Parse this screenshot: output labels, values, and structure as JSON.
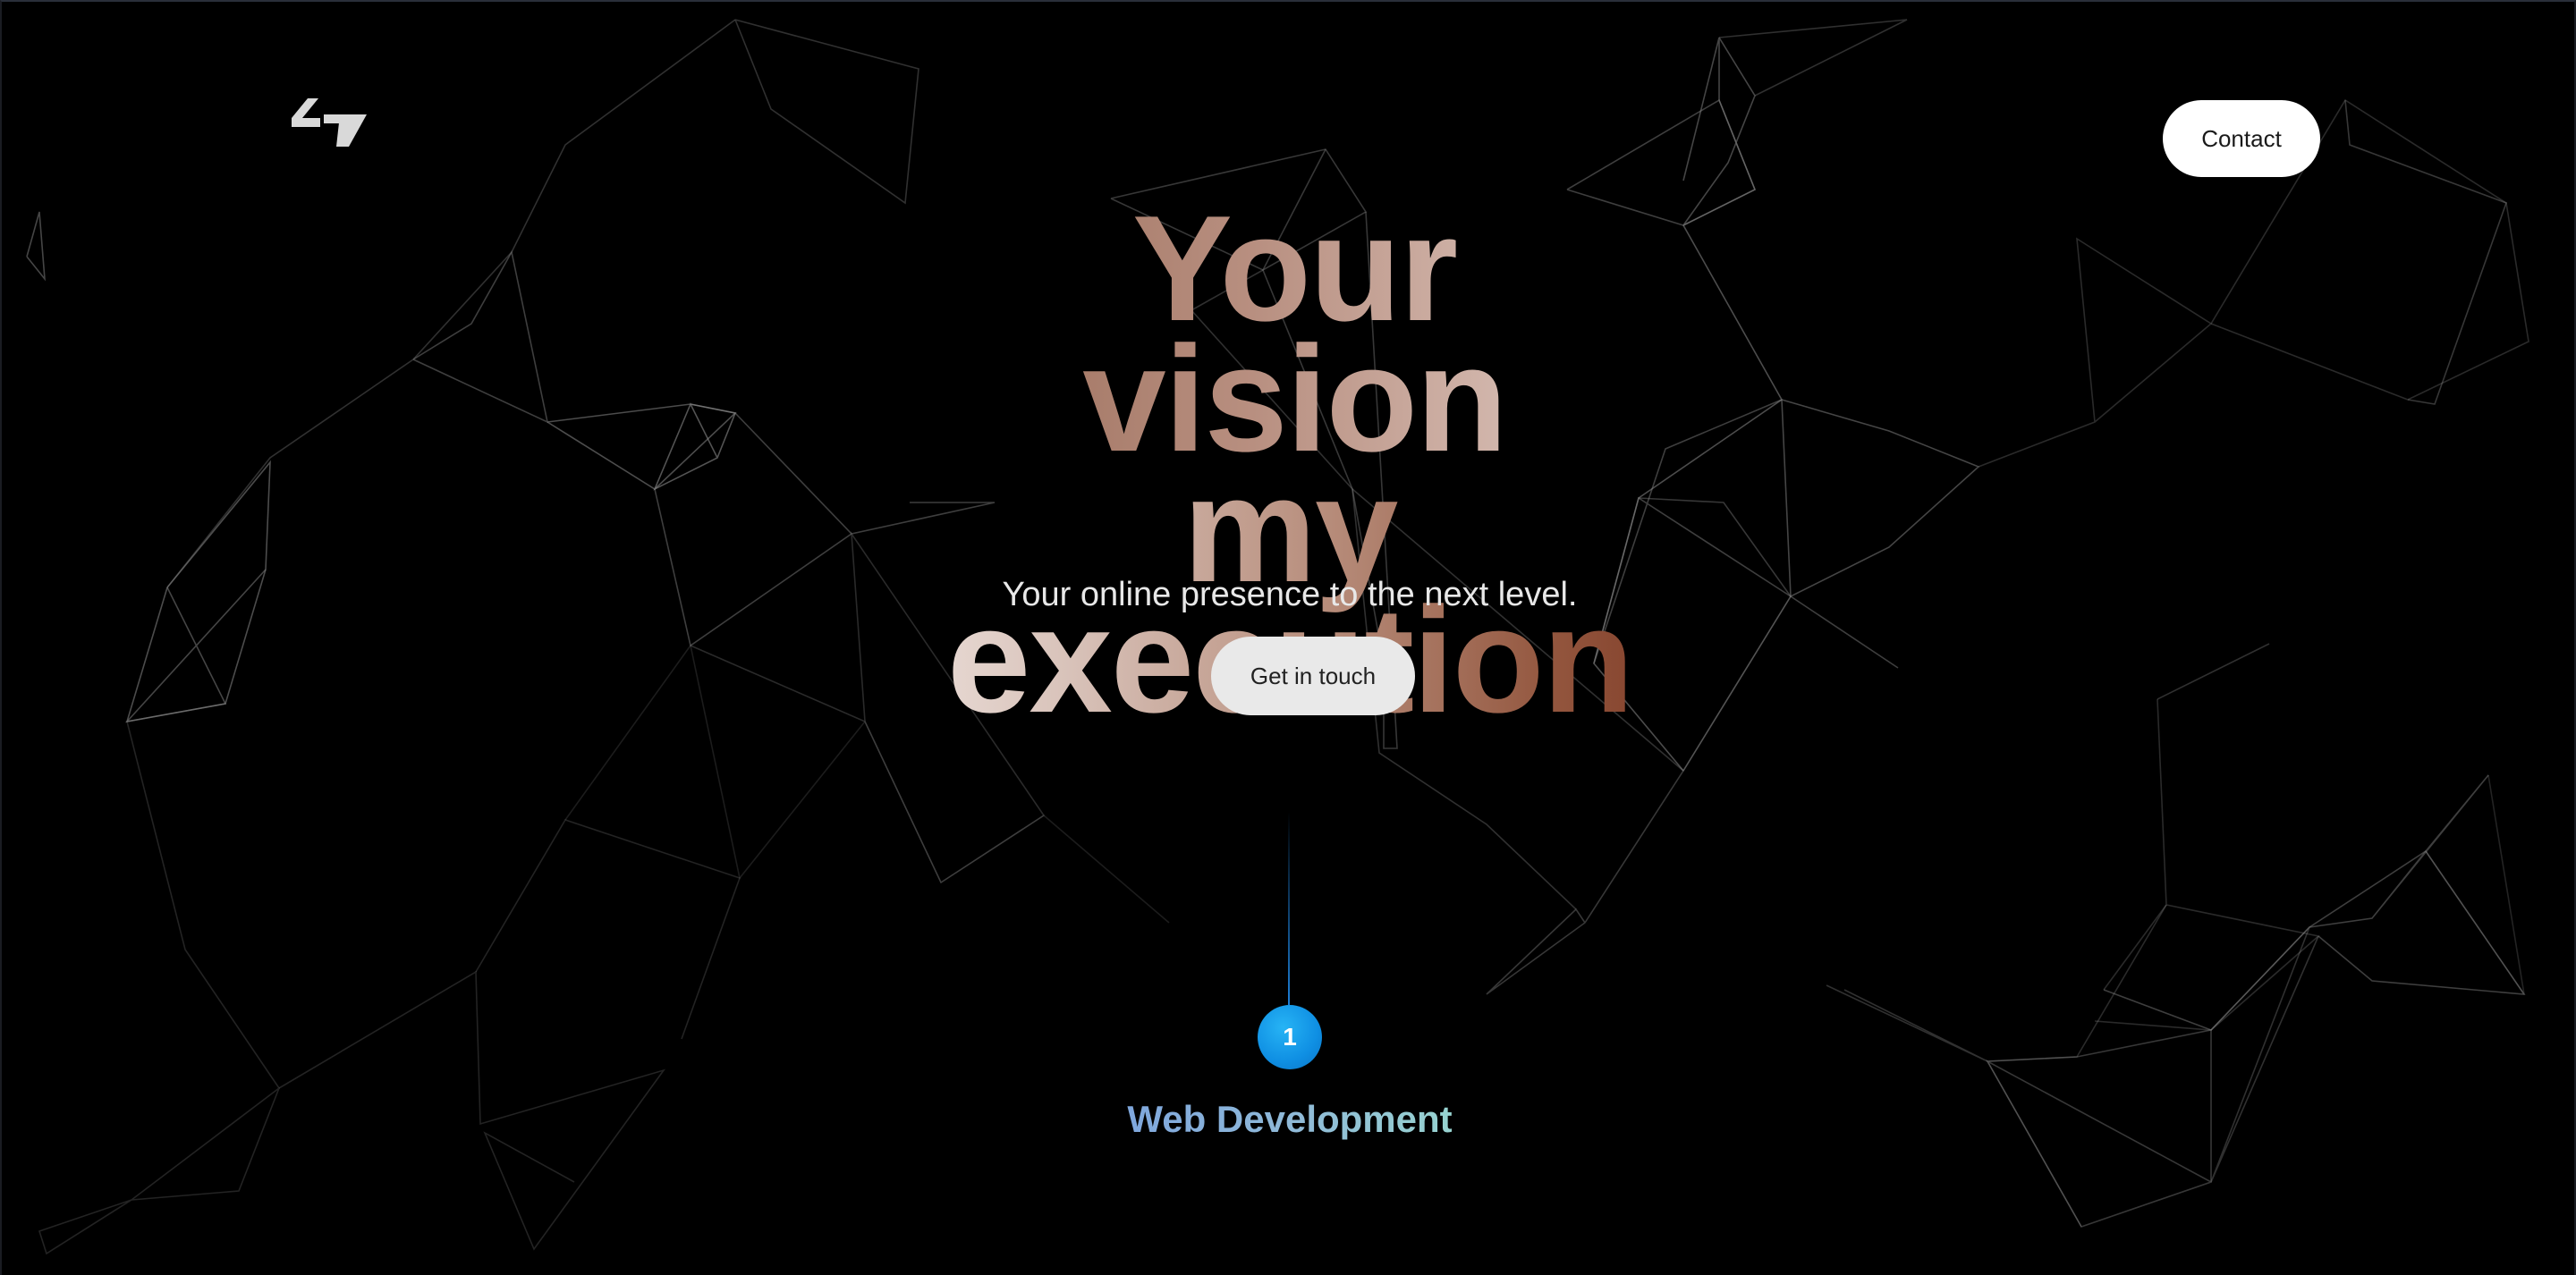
{
  "header": {
    "logo_icon": "brand-logo-icon",
    "contact_label": "Contact"
  },
  "hero": {
    "title_line1": "Your vision",
    "title_line2": "my execution",
    "subtitle": "Your online presence to the next level.",
    "cta_label": "Get in touch"
  },
  "services": {
    "step_number": "1",
    "step_title": "Web Development"
  },
  "colors": {
    "background": "#000000",
    "mesh_line": "#7a7a7a",
    "accent_blue": "#0f8fe3",
    "title_warm": "#93563e",
    "title_light": "#f0e6e2"
  }
}
